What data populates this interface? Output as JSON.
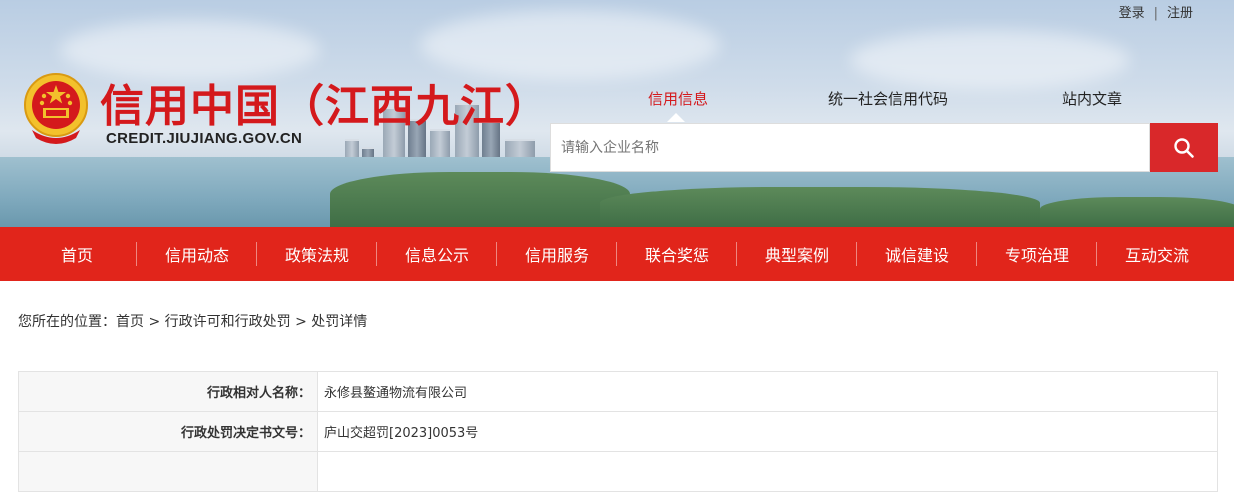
{
  "top_links": {
    "login": "登录",
    "separator": "|",
    "register": "注册"
  },
  "site": {
    "title": "信用中国（江西九江）",
    "domain": "CREDIT.JIUJIANG.GOV.CN"
  },
  "search": {
    "tabs": [
      "信用信息",
      "统一社会信用代码",
      "站内文章"
    ],
    "active_tab": 0,
    "placeholder": "请输入企业名称"
  },
  "nav": [
    "首页",
    "信用动态",
    "政策法规",
    "信息公示",
    "信用服务",
    "联合奖惩",
    "典型案例",
    "诚信建设",
    "专项治理",
    "互动交流"
  ],
  "breadcrumb": {
    "prefix": "您所在的位置：",
    "items": [
      "首页",
      "行政许可和行政处罚",
      "处罚详情"
    ],
    "separator": " > "
  },
  "detail_rows": [
    {
      "label": "行政相对人名称：",
      "value": "永修县鳌通物流有限公司"
    },
    {
      "label": "行政处罚决定书文号：",
      "value": "庐山交超罚[2023]0053号"
    },
    {
      "label": "",
      "value": ""
    }
  ],
  "colors": {
    "brand_red": "#e1251b",
    "title_red": "#d4191c"
  }
}
